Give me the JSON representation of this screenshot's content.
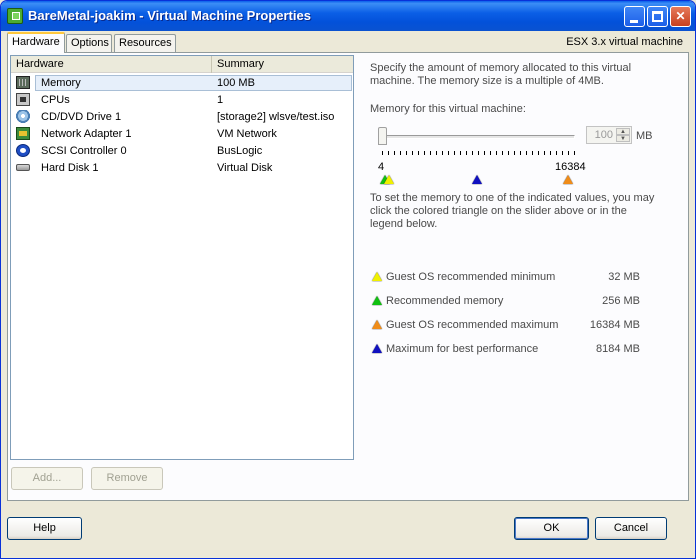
{
  "window": {
    "title": "BareMetal-joakim - Virtual Machine Properties"
  },
  "tabs": [
    {
      "label": "Hardware",
      "active": true
    },
    {
      "label": "Options",
      "active": false
    },
    {
      "label": "Resources",
      "active": false
    }
  ],
  "version_label": "ESX 3.x virtual machine",
  "hardware_table": {
    "columns": [
      "Hardware",
      "Summary"
    ],
    "rows": [
      {
        "icon": "memory-icon",
        "name": "Memory",
        "summary": "100 MB",
        "selected": true
      },
      {
        "icon": "cpu-icon",
        "name": "CPUs",
        "summary": "1"
      },
      {
        "icon": "cd-dvd-icon",
        "name": "CD/DVD Drive 1",
        "summary": "[storage2] wlsve/test.iso"
      },
      {
        "icon": "network-adapter-icon",
        "name": "Network Adapter 1",
        "summary": "VM Network"
      },
      {
        "icon": "scsi-controller-icon",
        "name": "SCSI Controller 0",
        "summary": "BusLogic"
      },
      {
        "icon": "hard-disk-icon",
        "name": "Hard Disk 1",
        "summary": "Virtual Disk"
      }
    ]
  },
  "memory_panel": {
    "description": "Specify the amount of memory allocated to this virtual machine. The memory size is a multiple of 4MB.",
    "slider_label": "Memory for this virtual machine:",
    "value": "100",
    "unit": "MB",
    "slider_min_label": "4",
    "slider_max_label": "16384",
    "hint": "To set the memory to one of the indicated values, you may click the colored triangle on the slider above or in the legend below.",
    "legend": [
      {
        "color": "#f0f000",
        "label": "Guest  OS  recommended  minimum",
        "value": "32 MB"
      },
      {
        "color": "#10c010",
        "label": "Recommended memory",
        "value": "256 MB"
      },
      {
        "color": "#f08c18",
        "label": "Guest  OS  recommended  maximum",
        "value": "16384 MB"
      },
      {
        "color": "#1010c0",
        "label": "Maximum for best performance",
        "value": "8184 MB"
      }
    ]
  },
  "buttons": {
    "add": "Add...",
    "remove": "Remove",
    "help": "Help",
    "ok": "OK",
    "cancel": "Cancel"
  }
}
